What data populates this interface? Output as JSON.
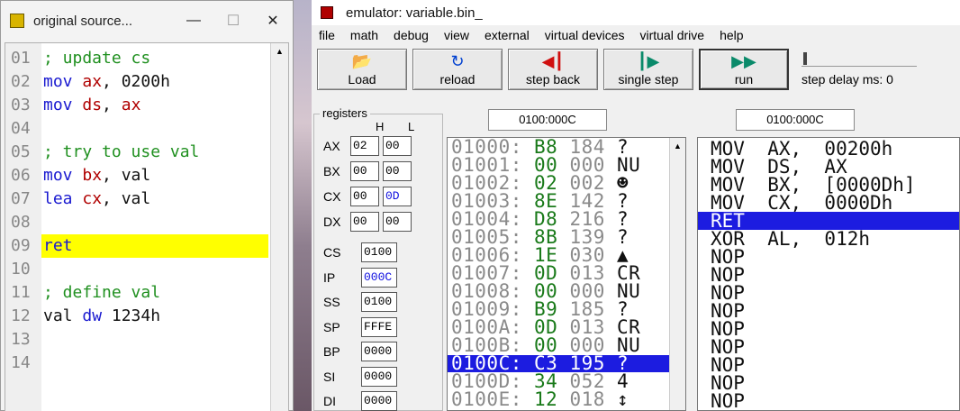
{
  "source_window": {
    "title": "original source...",
    "minimize": "—",
    "maximize": "☐",
    "close": "✕",
    "lines": [
      {
        "n": "01",
        "parts": [
          {
            "t": "; update cs",
            "k": "cm"
          }
        ]
      },
      {
        "n": "02",
        "parts": [
          {
            "t": "mov ",
            "k": "kw"
          },
          {
            "t": "ax",
            "k": "reg"
          },
          {
            "t": ", 0200h",
            "k": "tx"
          }
        ]
      },
      {
        "n": "03",
        "parts": [
          {
            "t": "mov ",
            "k": "kw"
          },
          {
            "t": "ds",
            "k": "reg"
          },
          {
            "t": ", ",
            "k": "tx"
          },
          {
            "t": "ax",
            "k": "reg"
          }
        ]
      },
      {
        "n": "04",
        "parts": []
      },
      {
        "n": "05",
        "parts": [
          {
            "t": "; try to use val",
            "k": "cm"
          }
        ]
      },
      {
        "n": "06",
        "parts": [
          {
            "t": "mov ",
            "k": "kw"
          },
          {
            "t": "bx",
            "k": "reg"
          },
          {
            "t": ", val",
            "k": "tx"
          }
        ]
      },
      {
        "n": "07",
        "parts": [
          {
            "t": "lea ",
            "k": "kw"
          },
          {
            "t": "cx",
            "k": "reg"
          },
          {
            "t": ", val",
            "k": "tx"
          }
        ]
      },
      {
        "n": "08",
        "parts": []
      },
      {
        "n": "09",
        "parts": [
          {
            "t": "ret",
            "k": "kw"
          }
        ],
        "highlight": true
      },
      {
        "n": "10",
        "parts": []
      },
      {
        "n": "11",
        "parts": [
          {
            "t": "; define val",
            "k": "cm"
          }
        ]
      },
      {
        "n": "12",
        "parts": [
          {
            "t": "val ",
            "k": "tx"
          },
          {
            "t": "dw ",
            "k": "kw"
          },
          {
            "t": "1234h",
            "k": "tx"
          }
        ]
      },
      {
        "n": "13",
        "parts": []
      },
      {
        "n": "14",
        "parts": []
      }
    ]
  },
  "emulator": {
    "title": "emulator: variable.bin_",
    "menu": [
      "file",
      "math",
      "debug",
      "view",
      "external",
      "virtual devices",
      "virtual drive",
      "help"
    ],
    "toolbar": {
      "load": "Load",
      "reload": "reload",
      "step_back": "step back",
      "single_step": "single step",
      "run": "run",
      "step_delay": "step delay ms: 0"
    },
    "registers": {
      "caption": "registers",
      "h": "H",
      "l": "L",
      "general": [
        {
          "name": "AX",
          "h": "02",
          "l": "00"
        },
        {
          "name": "BX",
          "h": "00",
          "l": "00"
        },
        {
          "name": "CX",
          "h": "00",
          "l": "0D",
          "l_changed": true
        },
        {
          "name": "DX",
          "h": "00",
          "l": "00"
        }
      ],
      "other": [
        {
          "name": "CS",
          "value": "0100"
        },
        {
          "name": "IP",
          "value": "000C",
          "changed": true
        },
        {
          "name": "SS",
          "value": "0100"
        },
        {
          "name": "SP",
          "value": "FFFE"
        },
        {
          "name": "BP",
          "value": "0000"
        },
        {
          "name": "SI",
          "value": "0000"
        },
        {
          "name": "DI",
          "value": "0000"
        }
      ]
    },
    "memory_address": "0100:000C",
    "disasm_address": "0100:000C",
    "memory": [
      {
        "addr": "01000:",
        "hex": "B8",
        "dec": "184",
        "ch": "?"
      },
      {
        "addr": "01001:",
        "hex": "00",
        "dec": "000",
        "ch": "NU"
      },
      {
        "addr": "01002:",
        "hex": "02",
        "dec": "002",
        "ch": "☻"
      },
      {
        "addr": "01003:",
        "hex": "8E",
        "dec": "142",
        "ch": "?"
      },
      {
        "addr": "01004:",
        "hex": "D8",
        "dec": "216",
        "ch": "?"
      },
      {
        "addr": "01005:",
        "hex": "8B",
        "dec": "139",
        "ch": "?"
      },
      {
        "addr": "01006:",
        "hex": "1E",
        "dec": "030",
        "ch": "▲"
      },
      {
        "addr": "01007:",
        "hex": "0D",
        "dec": "013",
        "ch": "CR"
      },
      {
        "addr": "01008:",
        "hex": "00",
        "dec": "000",
        "ch": "NU"
      },
      {
        "addr": "01009:",
        "hex": "B9",
        "dec": "185",
        "ch": "?"
      },
      {
        "addr": "0100A:",
        "hex": "0D",
        "dec": "013",
        "ch": "CR"
      },
      {
        "addr": "0100B:",
        "hex": "00",
        "dec": "000",
        "ch": "NU"
      },
      {
        "addr": "0100C:",
        "hex": "C3",
        "dec": "195",
        "ch": "?",
        "selected": true
      },
      {
        "addr": "0100D:",
        "hex": "34",
        "dec": "052",
        "ch": "4"
      },
      {
        "addr": "0100E:",
        "hex": "12",
        "dec": "018",
        "ch": "↕"
      }
    ],
    "disassembly": [
      {
        "text": "MOV  AX,  00200h"
      },
      {
        "text": "MOV  DS,  AX"
      },
      {
        "text": "MOV  BX,  [0000Dh]"
      },
      {
        "text": "MOV  CX,  0000Dh"
      },
      {
        "text": "RET",
        "selected": true
      },
      {
        "text": "XOR  AL,  012h"
      },
      {
        "text": "NOP"
      },
      {
        "text": "NOP"
      },
      {
        "text": "NOP"
      },
      {
        "text": "NOP"
      },
      {
        "text": "NOP"
      },
      {
        "text": "NOP"
      },
      {
        "text": "NOP"
      },
      {
        "text": "NOP"
      },
      {
        "text": "NOP"
      }
    ]
  }
}
